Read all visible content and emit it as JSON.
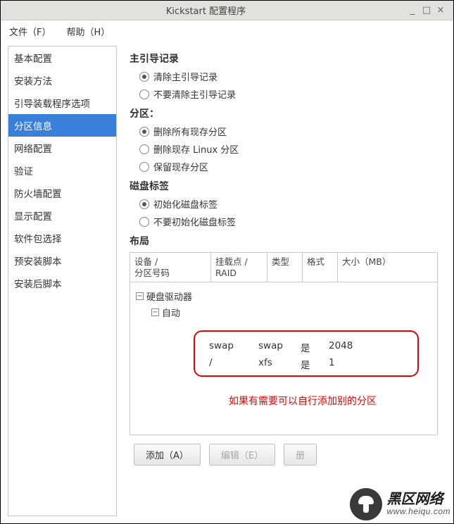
{
  "window": {
    "title": "Kickstart 配置程序",
    "btn_min": "_",
    "btn_max": "□",
    "btn_close": "×"
  },
  "menu": {
    "file": "文件（F）",
    "help": "帮助（H）"
  },
  "sidebar": {
    "items": [
      "基本配置",
      "安装方法",
      "引导装载程序选项",
      "分区信息",
      "网络配置",
      "验证",
      "防火墙配置",
      "显示配置",
      "软件包选择",
      "预安装脚本",
      "安装后脚本"
    ],
    "selected_index": 3
  },
  "sections": {
    "mbr": {
      "title": "主引导记录",
      "opts": [
        "清除主引导记录",
        "不要清除主引导记录"
      ],
      "selected": 0
    },
    "partitions": {
      "title": "分区：",
      "opts": [
        "删除所有现存分区",
        "删除现存 Linux 分区",
        "保留现存分区"
      ],
      "selected": 0
    },
    "disklabel": {
      "title": "磁盘标签",
      "opts": [
        "初始化磁盘标签",
        "不要初始化磁盘标签"
      ],
      "selected": 0
    },
    "layout": {
      "title": "布局",
      "headers": {
        "device": "设备 /\n分区号码",
        "mount": "挂载点 /\nRAID",
        "type": "类型",
        "format": "格式",
        "size": "大小（MB）"
      },
      "tree_root": "硬盘驱动器",
      "tree_auto": "自动",
      "expander_symbol": "−",
      "rows": [
        {
          "mount": "swap",
          "type": "swap",
          "format": "是",
          "size": "2048"
        },
        {
          "mount": "/",
          "type": "xfs",
          "format": "是",
          "size": "1"
        }
      ],
      "annotation": "如果有需要可以自行添加别的分区"
    }
  },
  "buttons": {
    "add": "添加（A）",
    "edit": "编辑（E）",
    "delete_partial": "册"
  },
  "watermark": {
    "line1": "黑区网络",
    "line2": "www.heiqu.com"
  }
}
